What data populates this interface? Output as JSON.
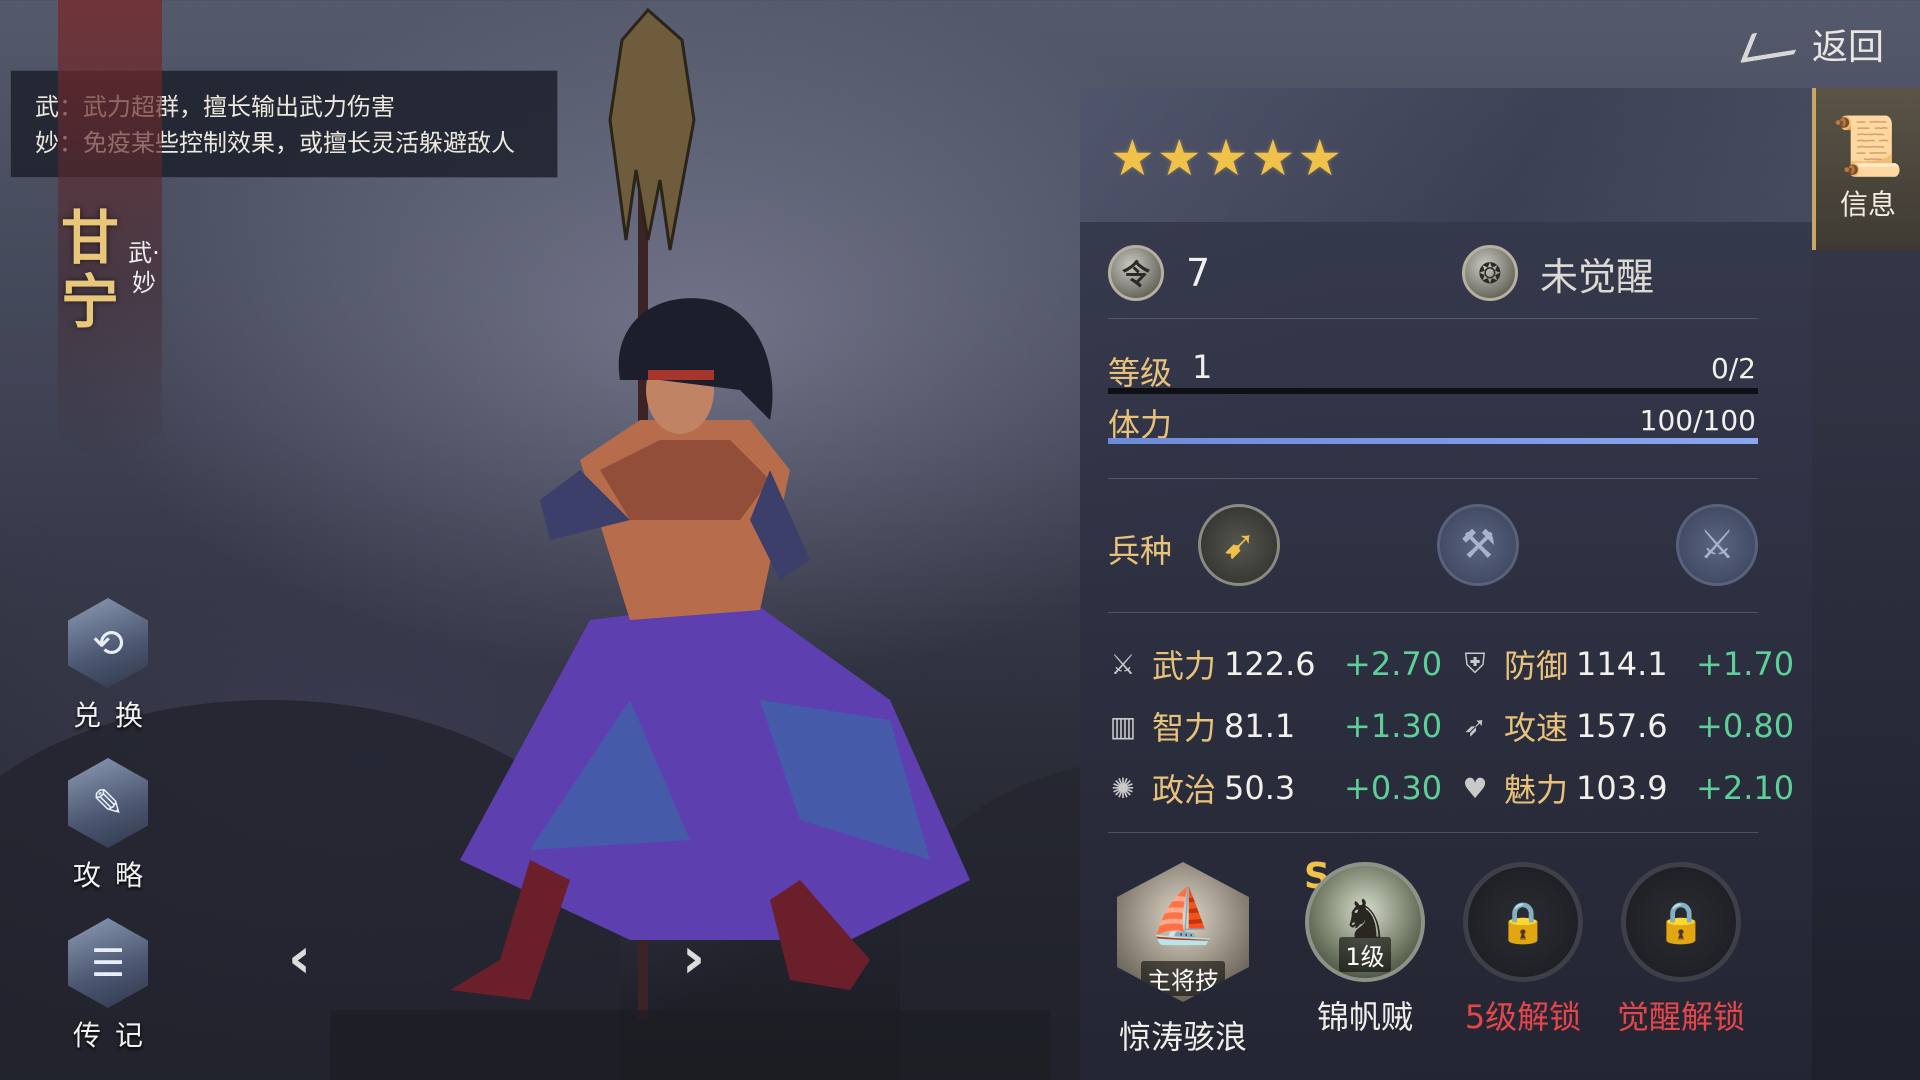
{
  "tooltip": {
    "line1": "武：武力超群，擅长输出武力伤害",
    "line2": "妙：免疫某些控制效果，或擅长灵活躲避敌人"
  },
  "hero": {
    "name": "甘宁",
    "type": "武·妙",
    "stars": 5
  },
  "nav": {
    "exchange": "兑换",
    "guide": "攻略",
    "biography": "传记",
    "prev_icon": "chevron-left-icon",
    "next_icon": "chevron-right-icon"
  },
  "header": {
    "back_label": "返回",
    "info_tab": "信息"
  },
  "status": {
    "command_value": "7",
    "awaken_status": "未觉醒"
  },
  "level": {
    "label": "等级",
    "value": "1",
    "exp": "0/2",
    "exp_fraction": 0
  },
  "stamina": {
    "label": "体力",
    "value": "100/100",
    "fraction": 1
  },
  "troops": {
    "label": "兵种",
    "items": [
      "spear-icon",
      "axe-icon",
      "blade-icon"
    ],
    "active_index": 0
  },
  "stats": [
    {
      "name": "武力",
      "value": "122.6",
      "bonus": "+2.70",
      "icon": "sword-icon"
    },
    {
      "name": "防御",
      "value": "114.1",
      "bonus": "+1.70",
      "icon": "shield-icon"
    },
    {
      "name": "智力",
      "value": "81.1",
      "bonus": "+1.30",
      "icon": "scroll-icon"
    },
    {
      "name": "攻速",
      "value": "157.6",
      "bonus": "+0.80",
      "icon": "boot-icon"
    },
    {
      "name": "政治",
      "value": "50.3",
      "bonus": "+0.30",
      "icon": "emblem-icon"
    },
    {
      "name": "魅力",
      "value": "103.9",
      "bonus": "+2.10",
      "icon": "heart-icon"
    }
  ],
  "skills": [
    {
      "name": "惊涛骇浪",
      "tag": "主将技"
    },
    {
      "name": "锦帆贼",
      "tag": "1级",
      "grade": "S"
    },
    {
      "name": "5级解锁"
    },
    {
      "name": "觉醒解锁"
    }
  ],
  "colors": {
    "accent_gold": "#e8c27a",
    "bonus_green": "#5ecf98",
    "locked_red": "#e5464a",
    "stamina_bar": "#7b98e4"
  }
}
